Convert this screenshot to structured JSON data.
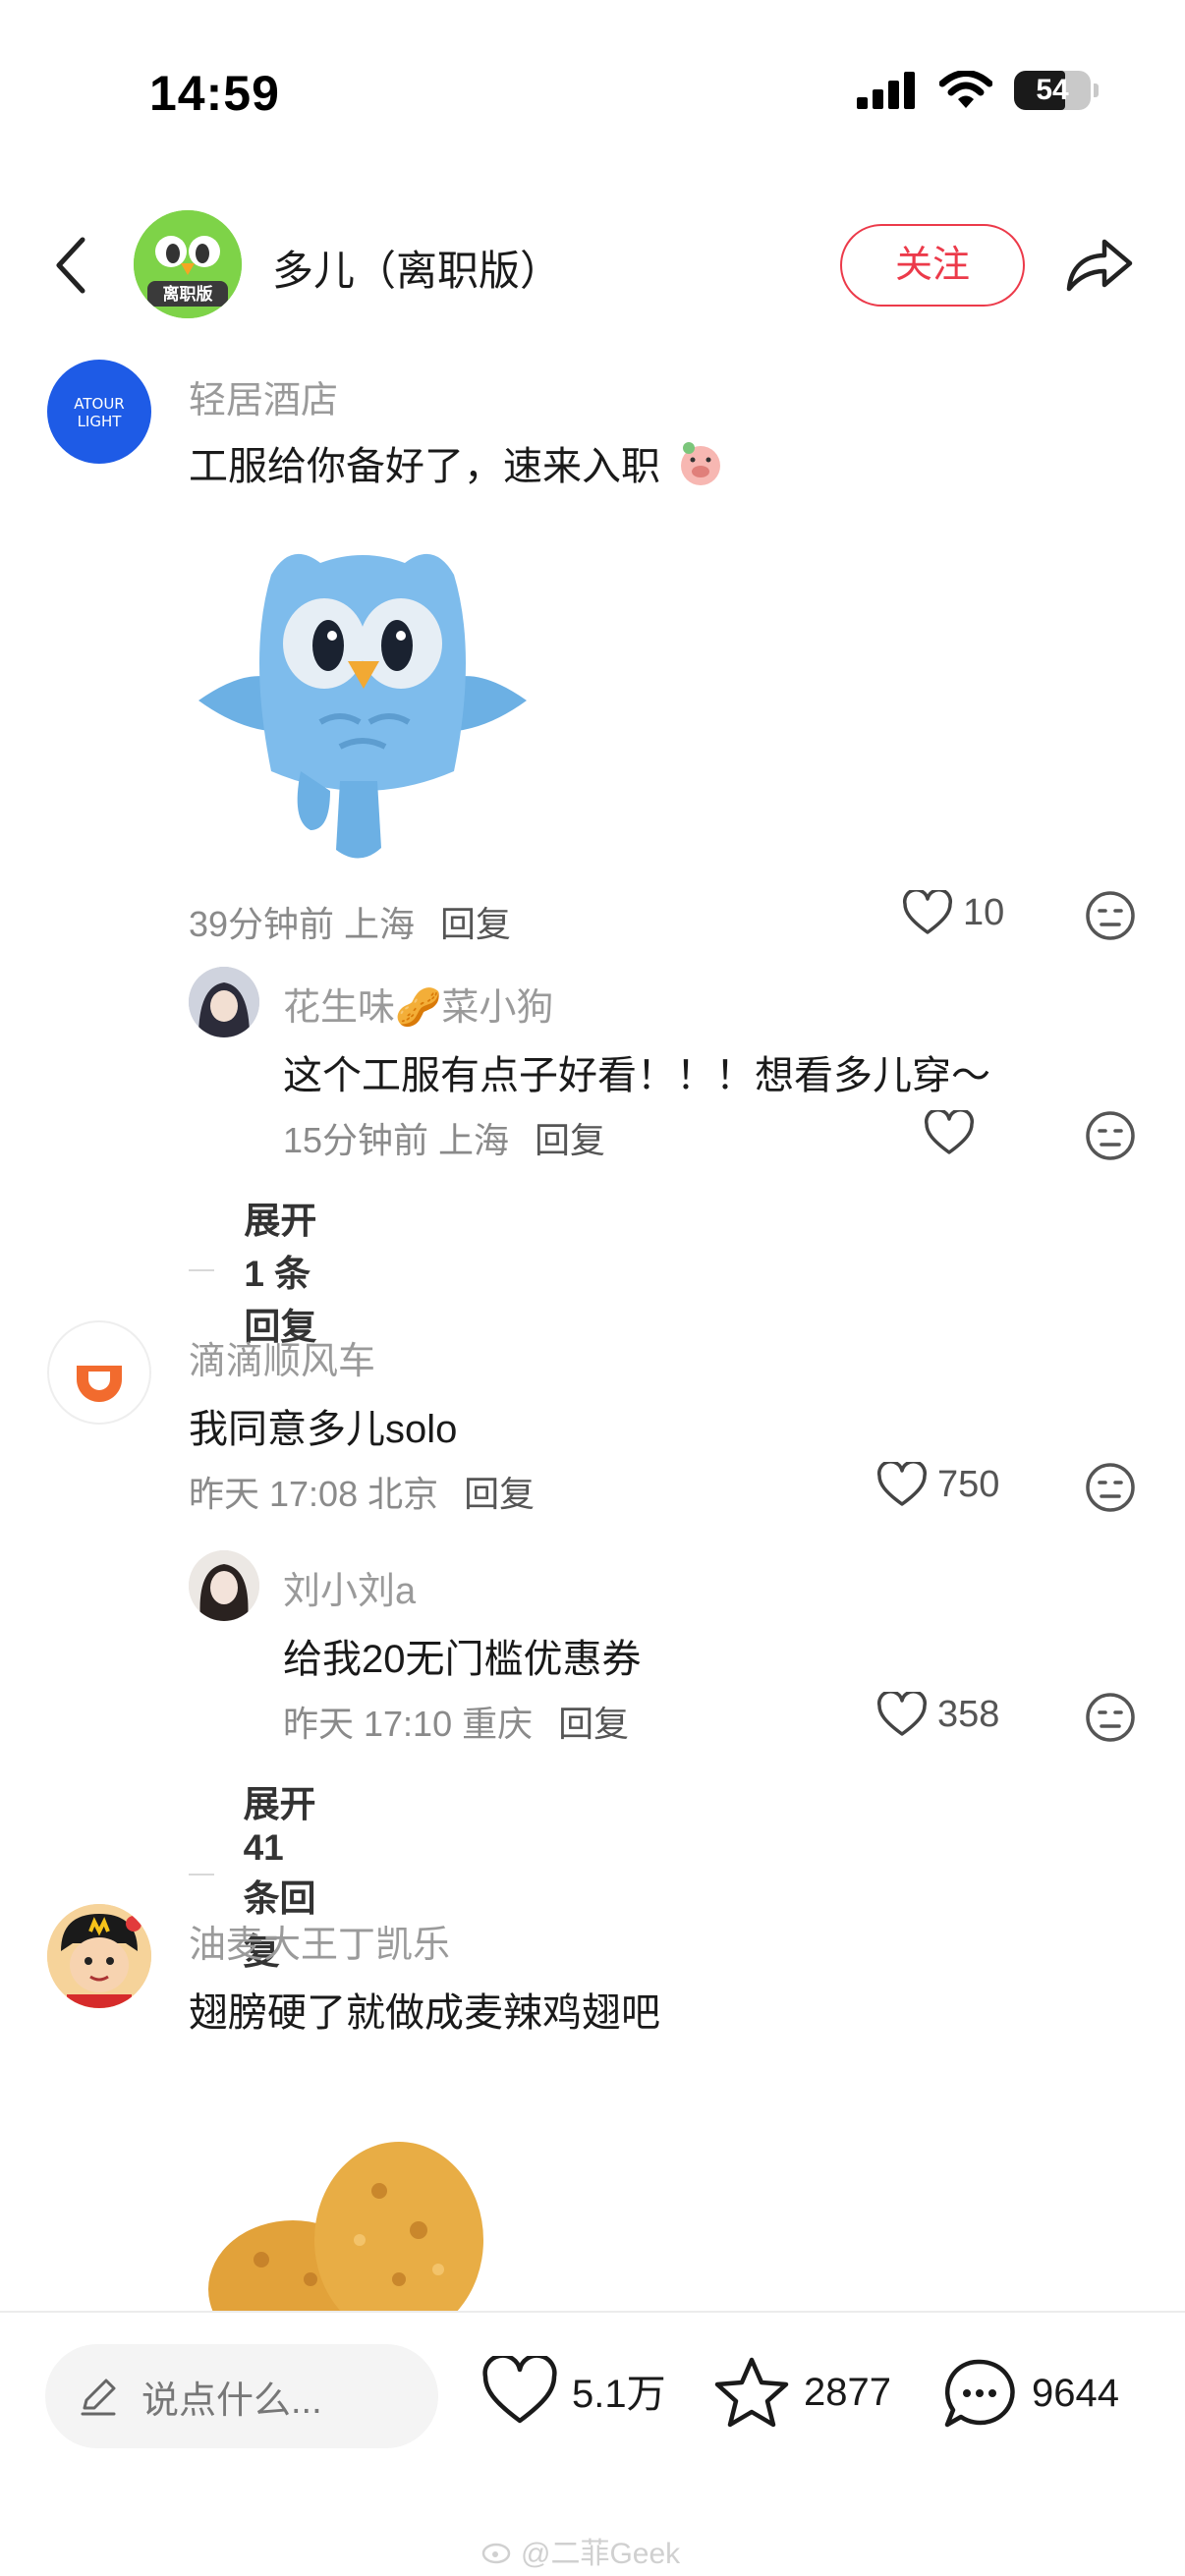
{
  "status": {
    "time": "14:59",
    "battery": "54"
  },
  "header": {
    "title": "多儿（离职版）",
    "avatar_badge": "离职版",
    "follow_label": "关注"
  },
  "comments": [
    {
      "user": "轻居酒店",
      "avatar_text_1": "ATOUR",
      "avatar_text_2": "LIGHT",
      "text": "工服给你备好了，速来入职",
      "meta": "39分钟前 上海",
      "reply_label": "回复",
      "likes": "10",
      "replies": [
        {
          "user": "花生味🥜菜小狗",
          "text": "这个工服有点子好看！！！想看多儿穿～",
          "meta": "15分钟前 上海",
          "reply_label": "回复",
          "likes": ""
        }
      ],
      "expand_label": "展开 1 条回复"
    },
    {
      "user": "滴滴顺风车",
      "text": "我同意多儿solo",
      "meta": "昨天 17:08 北京",
      "reply_label": "回复",
      "likes": "750",
      "replies": [
        {
          "user": "刘小刘a",
          "text": "给我20无门槛优惠券",
          "meta": "昨天 17:10 重庆",
          "reply_label": "回复",
          "likes": "358"
        }
      ],
      "expand_label": "展开 41 条回复"
    },
    {
      "user": "油麦大王丁凯乐",
      "text": "翅膀硬了就做成麦辣鸡翅吧"
    }
  ],
  "bottom": {
    "input_placeholder": "说点什么...",
    "likes": "5.1万",
    "favorites": "2877",
    "comments": "9644"
  },
  "watermark": "@二菲Geek",
  "colors": {
    "accent": "#ec3a4a",
    "duo_green": "#7ed348",
    "atour_blue": "#1e5be6",
    "didi_orange": "#f26b2e"
  }
}
